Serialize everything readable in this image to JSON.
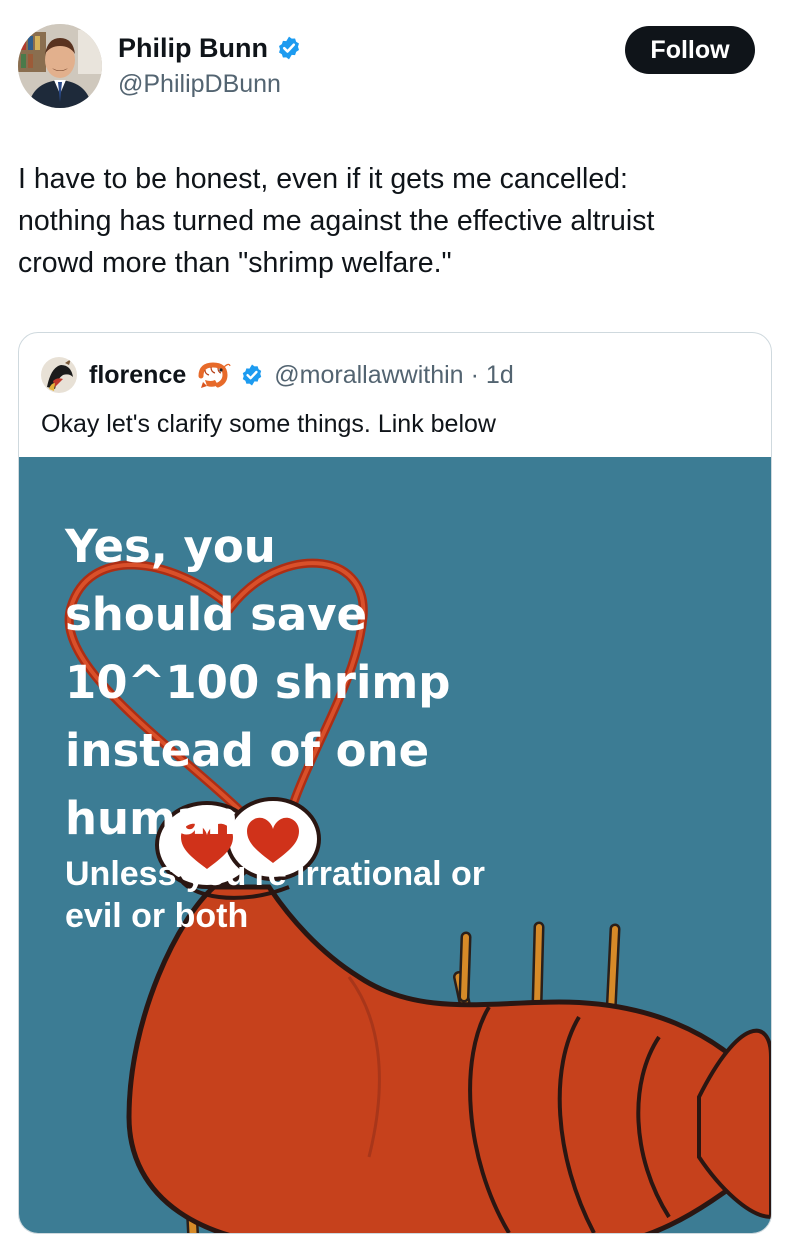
{
  "tweet": {
    "author": {
      "name": "Philip Bunn",
      "handle": "@PhilipDBunn"
    },
    "follow_label": "Follow",
    "text": "I have to be honest, even if it gets me cancelled:\nnothing has turned me against the effective altruist\ncrowd more than \"shrimp welfare.\"",
    "quote": {
      "name": "florence",
      "handle": "@morallawwithin",
      "separator": "·",
      "time": "1d",
      "text": "Okay let's clarify some things. Link below",
      "image": {
        "headline": "Yes, you\nshould save\n10^100 shrimp\ninstead of one\nhuman",
        "subtext": "Unless you're irrational or\nevil or both"
      }
    }
  },
  "colors": {
    "verified_blue": "#1d9bf0",
    "image_background": "#3c7c94",
    "shrimp_red": "#c6411c",
    "follow_button": "#0f1419"
  },
  "icons": [
    "verified-badge-icon",
    "shrimp-emoji-icon"
  ]
}
